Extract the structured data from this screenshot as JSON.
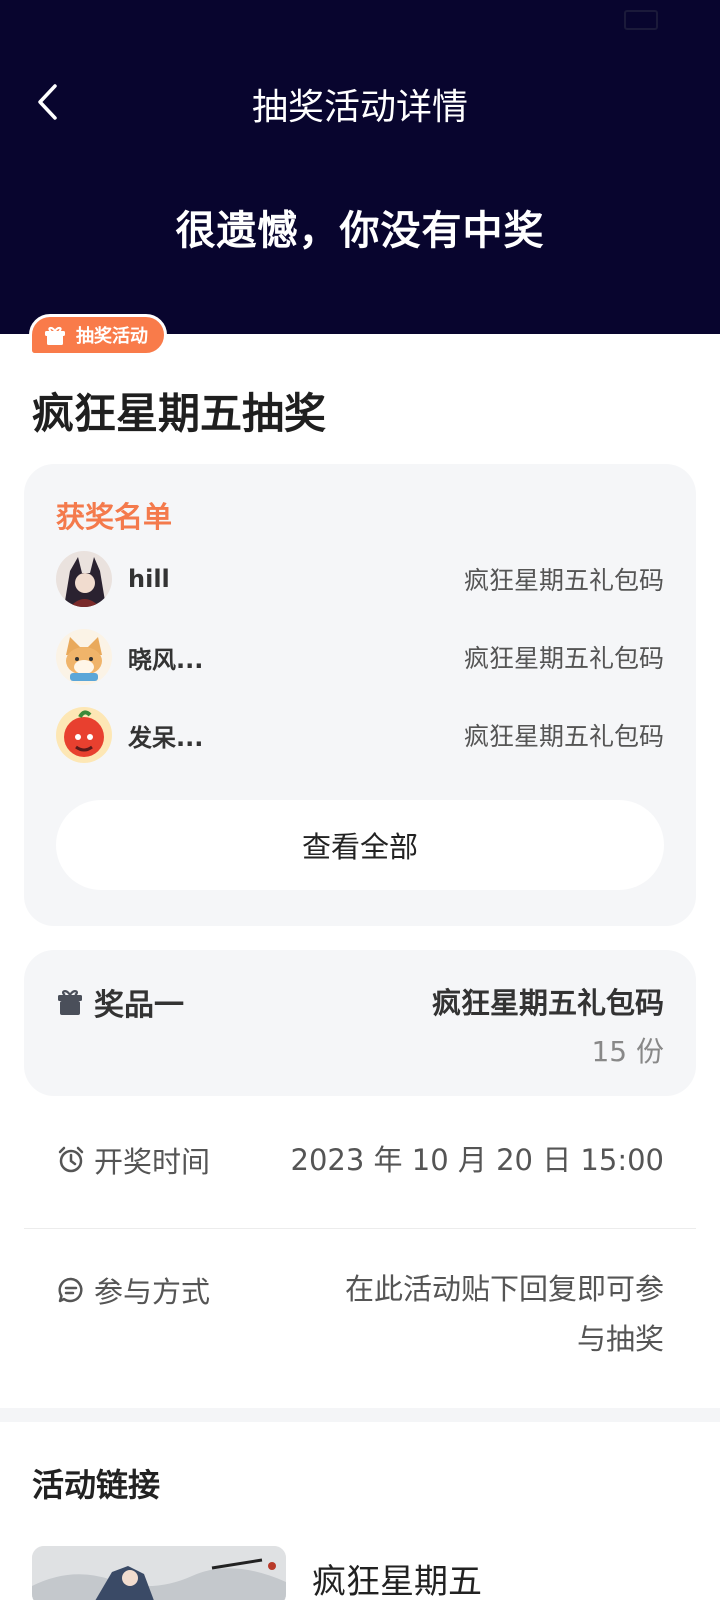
{
  "status_bar": {
    "left": "",
    "right": ""
  },
  "nav": {
    "title": "抽奖活动详情"
  },
  "result": {
    "text": "很遗憾，你没有中奖"
  },
  "tag": {
    "label": "抽奖活动"
  },
  "activity": {
    "title": "疯狂星期五抽奖"
  },
  "winners": {
    "heading": "获奖名单",
    "rows": [
      {
        "name": "hill",
        "prize": "疯狂星期五礼包码"
      },
      {
        "name": "晓风...",
        "prize": "疯狂星期五礼包码"
      },
      {
        "name": "发呆...",
        "prize": "疯狂星期五礼包码"
      }
    ],
    "view_all": "查看全部"
  },
  "prize": {
    "label": "奖品一",
    "name": "疯狂星期五礼包码",
    "count": "15 份"
  },
  "draw_time": {
    "label": "开奖时间",
    "value": "2023 年 10 月 20 日 15:00"
  },
  "participation": {
    "label": "参与方式",
    "value_line1": "在此活动贴下回复即可参",
    "value_line2": "与抽奖"
  },
  "links": {
    "title": "活动链接",
    "item_title": "疯狂星期五"
  },
  "colors": {
    "header_bg": "#08052e",
    "accent": "#f47a4c",
    "card_bg": "#f5f6f8"
  }
}
